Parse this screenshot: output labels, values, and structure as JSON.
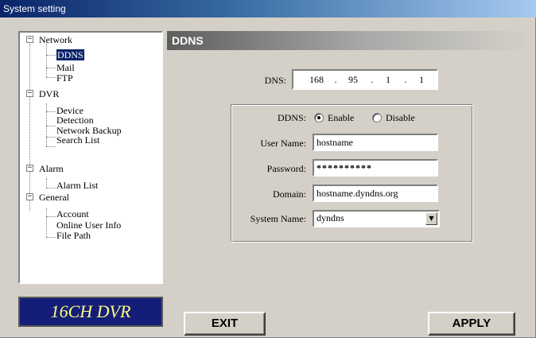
{
  "window": {
    "title": "System setting"
  },
  "tree": [
    {
      "label": "Network",
      "toggle": "−"
    },
    {
      "label": "DDNS",
      "selected": true
    },
    {
      "label": "Mail"
    },
    {
      "label": "FTP"
    },
    {
      "label": "DVR",
      "toggle": "−"
    },
    {
      "label": "Device"
    },
    {
      "label": "Detection"
    },
    {
      "label": "Network Backup"
    },
    {
      "label": "Search List"
    },
    {
      "label": "Alarm",
      "toggle": "−"
    },
    {
      "label": "Alarm List"
    },
    {
      "label": "General",
      "toggle": "−"
    },
    {
      "label": "Account"
    },
    {
      "label": "Online User Info"
    },
    {
      "label": "File Path"
    }
  ],
  "logo": {
    "text": "16CH DVR"
  },
  "page": {
    "title": "DDNS"
  },
  "dns": {
    "label": "DNS:",
    "octets": [
      "168",
      "95",
      "1",
      "1"
    ],
    "separator": "."
  },
  "ddns": {
    "label": "DDNS:",
    "enable_label": "Enable",
    "disable_label": "Disable",
    "selected": "enable"
  },
  "form": {
    "user_name_label": "User Name:",
    "user_name_value": "hostname",
    "password_label": "Password:",
    "password_value": "**********",
    "domain_label": "Domain:",
    "domain_value": "hostname.dyndns.org",
    "system_name_label": "System Name:",
    "system_name_value": "dyndns"
  },
  "buttons": {
    "exit": "EXIT",
    "apply": "APPLY"
  },
  "icons": {
    "dropdown": "chevron-down-icon",
    "tree_toggle": "minus-box-icon"
  }
}
